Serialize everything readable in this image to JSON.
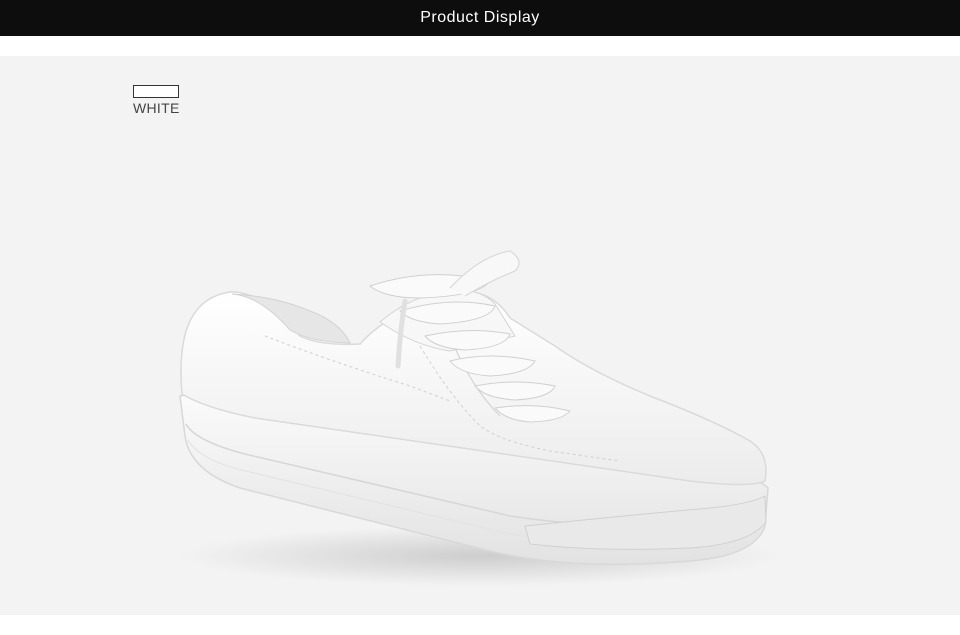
{
  "header": {
    "title": "Product Display"
  },
  "color_option": {
    "label": "WHITE",
    "swatch_color": "#ffffff"
  },
  "product": {
    "image": "white-leather-lace-up-sneaker"
  },
  "colors": {
    "header_bg": "#0d0d0d",
    "stage_bg": "#f3f3f3"
  }
}
